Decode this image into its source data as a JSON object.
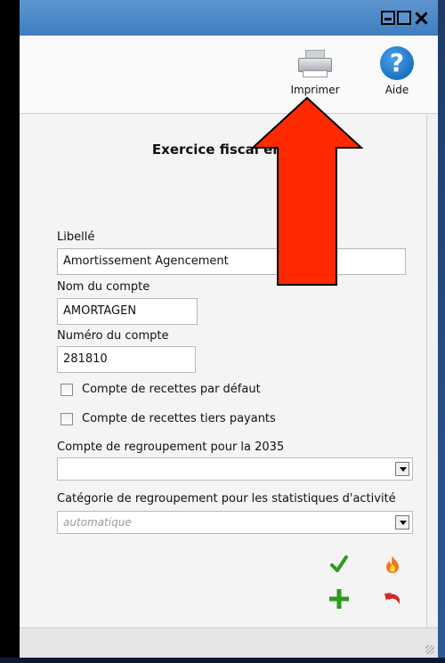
{
  "window": {
    "controls": [
      "minimize",
      "maximize",
      "close"
    ]
  },
  "toolbar": {
    "print_label": "Imprimer",
    "help_label": "Aide",
    "help_glyph": "?"
  },
  "form": {
    "title": "Exercice fiscal en c",
    "libelle_label": "Libellé",
    "libelle_value": "Amortissement Agencement",
    "nom_compte_label": "Nom du compte",
    "nom_compte_value": "AMORTAGEN",
    "numero_compte_label": "Numéro du compte",
    "numero_compte_value": "281810",
    "checkbox_recettes_defaut": "Compte de recettes par défaut",
    "checkbox_recettes_tiers": "Compte de recettes tiers payants",
    "regroupement_2035_label": "Compte de regroupement pour la 2035",
    "regroupement_2035_value": "",
    "categorie_label": "Catégorie de regroupement pour les statistiques d'activité",
    "categorie_value": "automatique"
  },
  "actions": {
    "icons": [
      "check-icon",
      "flame-icon",
      "plus-icon",
      "undo-icon"
    ]
  },
  "colors": {
    "titlebar": "#4f89c8",
    "annotation_arrow": "#ff2a00",
    "check": "#2e9a1e",
    "plus": "#2e9a1e",
    "undo": "#d2282a",
    "flame": "#f07a18"
  }
}
